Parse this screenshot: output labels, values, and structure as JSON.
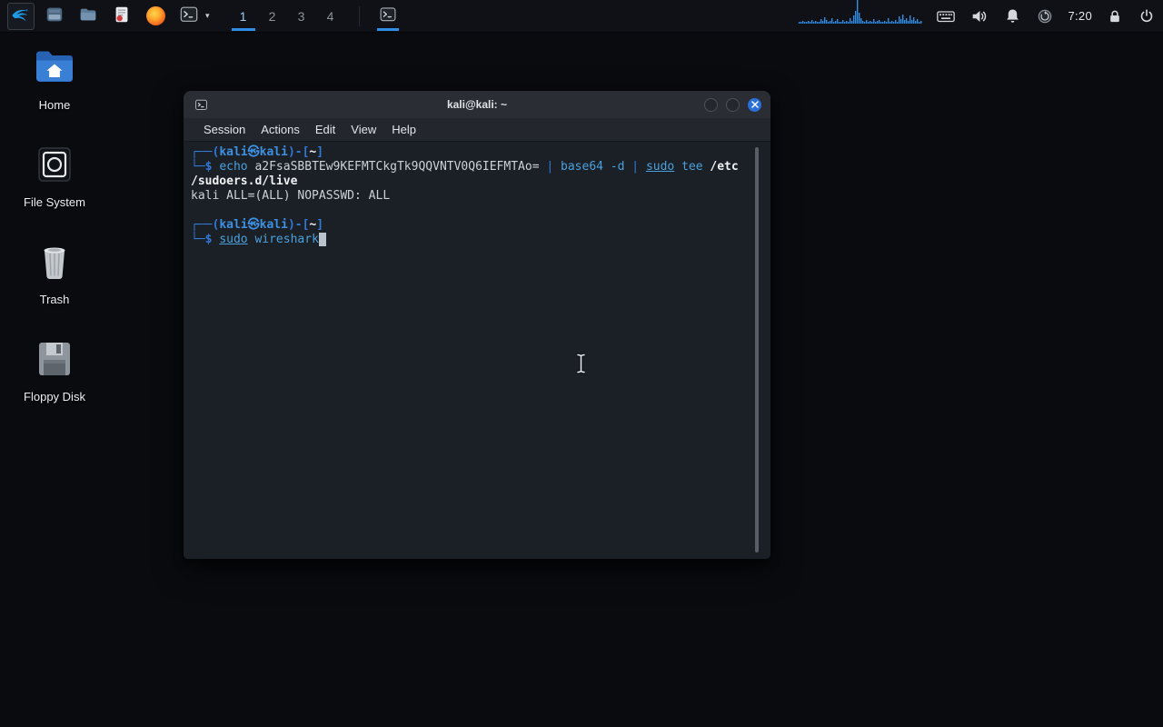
{
  "colors": {
    "accent_blue": "#2f8fe6",
    "panel_bg": "#0f1116",
    "desktop_bg": "#090b0f",
    "terminal_bg": "#1b2026",
    "titlebar_bg": "#2a2e34",
    "close_button": "#2b6fd8",
    "prompt_blue": "#3178d6",
    "command_blue": "#4aa0dc",
    "terminal_fg": "#ccd1d8"
  },
  "panel": {
    "launcher_icons": [
      "kali-menu",
      "file-manager",
      "folder",
      "text-editor",
      "firefox",
      "terminal",
      "terminal-dropdown-chevron"
    ],
    "workspaces": [
      "1",
      "2",
      "3",
      "4"
    ],
    "active_workspace": "1",
    "taskbar_windows": [
      "terminal"
    ],
    "cpu_graph": {
      "color": "#2f8fe6",
      "bars": [
        2,
        2,
        3,
        2,
        2,
        3,
        2,
        4,
        2,
        3,
        2,
        2,
        5,
        3,
        7,
        4,
        2,
        3,
        6,
        2,
        3,
        5,
        2,
        2,
        4,
        2,
        3,
        2,
        6,
        3,
        9,
        14,
        26,
        12,
        6,
        3,
        2,
        4,
        2,
        3,
        2,
        5,
        2,
        3,
        4,
        2,
        2,
        3,
        2,
        6,
        2,
        3,
        2,
        4,
        2,
        8,
        5,
        10,
        4,
        6,
        3,
        9,
        4,
        7,
        3,
        5,
        2,
        3
      ]
    },
    "tray_icons": [
      "keyboard",
      "volume",
      "notifications",
      "status-circle",
      "lock",
      "power"
    ],
    "clock": "7:20"
  },
  "desktop": {
    "icons": [
      {
        "label": "Home",
        "icon": "home-folder"
      },
      {
        "label": "File System",
        "icon": "file-system-drive"
      },
      {
        "label": "Trash",
        "icon": "trash-can"
      },
      {
        "label": "Floppy Disk",
        "icon": "floppy-disk"
      }
    ]
  },
  "terminal_window": {
    "title": "kali@kali: ~",
    "window_buttons": [
      "minimize",
      "maximize",
      "close"
    ],
    "menu": [
      "Session",
      "Actions",
      "Edit",
      "View",
      "Help"
    ],
    "lines": [
      [
        {
          "text": "┌──(",
          "style": "prompt"
        },
        {
          "text": "kali㉿kali",
          "style": "user"
        },
        {
          "text": ")-[",
          "style": "prompt"
        },
        {
          "text": "~",
          "style": "path"
        },
        {
          "text": "]",
          "style": "prompt"
        }
      ],
      [
        {
          "text": "└─$ ",
          "style": "prompt"
        },
        {
          "text": "echo",
          "style": "cmd"
        },
        {
          "text": " a2FsaSBBTEw9KEFMTCkgTk9QQVNTV0Q6IEFMTAo= ",
          "style": "fg"
        },
        {
          "text": "| ",
          "style": "op"
        },
        {
          "text": "base64",
          "style": "cmd"
        },
        {
          "text": " -d ",
          "style": "cmd"
        },
        {
          "text": "| ",
          "style": "op"
        },
        {
          "text": "sudo",
          "style": "sudo"
        },
        {
          "text": " ",
          "style": "fg"
        },
        {
          "text": "tee",
          "style": "cmd"
        },
        {
          "text": " ",
          "style": "fg"
        },
        {
          "text": "/etc",
          "style": "bold"
        }
      ],
      [
        {
          "text": "/sudoers.d/live",
          "style": "bold"
        }
      ],
      [
        {
          "text": "kali ALL=(ALL) NOPASSWD: ALL",
          "style": "fg"
        }
      ],
      [],
      [
        {
          "text": "┌──(",
          "style": "prompt"
        },
        {
          "text": "kali㉿kali",
          "style": "user"
        },
        {
          "text": ")-[",
          "style": "prompt"
        },
        {
          "text": "~",
          "style": "path"
        },
        {
          "text": "]",
          "style": "prompt"
        }
      ],
      [
        {
          "text": "└─$ ",
          "style": "prompt"
        },
        {
          "text": "sudo",
          "style": "sudo"
        },
        {
          "text": " ",
          "style": "fg"
        },
        {
          "text": "wireshark",
          "style": "cmd"
        },
        {
          "text": " ",
          "style": "cursor"
        }
      ]
    ]
  }
}
